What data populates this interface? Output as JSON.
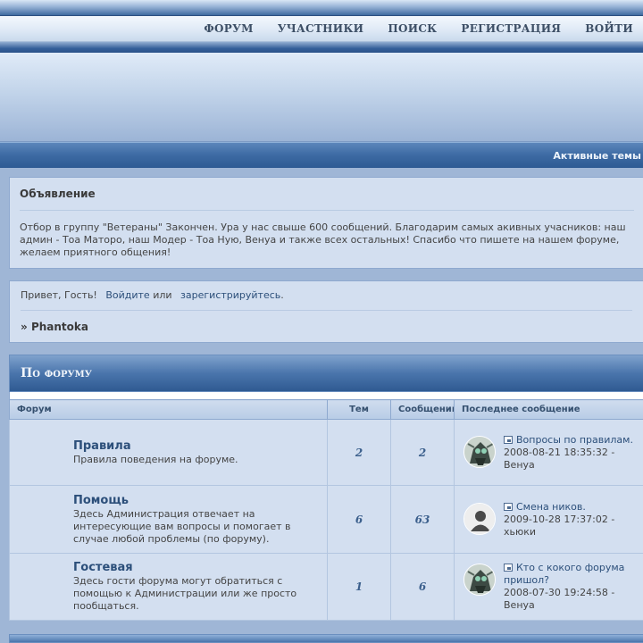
{
  "nav": {
    "items": [
      {
        "label": "ФОРУМ"
      },
      {
        "label": "УЧАСТНИКИ"
      },
      {
        "label": "ПОИСК"
      },
      {
        "label": "РЕГИСТРАЦИЯ"
      },
      {
        "label": "ВОЙТИ"
      }
    ]
  },
  "subbar": {
    "active_topics": "Активные темы"
  },
  "announcement": {
    "title": "Объявление",
    "text": "Отбор в группу \"Ветераны\" Закончен. Ура у нас свыше 600 сообщений. Благодарим самых акивных учасников: наш админ - Тоа Маторо, наш Модер - Тоа Ную, Венуа и также всех остальных! Спасибо что пишете на нашем форуме, желаем приятного общения!"
  },
  "welcome": {
    "greeting": "Привет, Гость!",
    "login": "Войдите",
    "or": "или",
    "register": "зарегистрируйтесь",
    "period": ".",
    "crumb_prefix": "»",
    "crumb": "Phantoka"
  },
  "category": {
    "title": "По форуму",
    "headers": {
      "forum": "Форум",
      "topics": "Тем",
      "posts": "Сообщений",
      "last": "Последнее сообщение"
    },
    "rows": [
      {
        "title": "Правила",
        "desc": "Правила поведения на форуме.",
        "topics": "2",
        "posts": "2",
        "last_topic": "Вопросы по правилам.",
        "last_date": "2008-08-21 18:35:32 -",
        "last_user": "Венуа",
        "avatar": "robot-avatar-icon"
      },
      {
        "title": "Помощь",
        "desc": "Здесь Администрация отвечает на интересующие вам вопросы и помогает в случае любой проблемы (по форуму).",
        "topics": "6",
        "posts": "63",
        "last_topic": "Смена ников.",
        "last_date": "2009-10-28 17:37:02 -",
        "last_user": "хьюки",
        "avatar": "default-user-avatar-icon"
      },
      {
        "title": "Гостевая",
        "desc": "Здесь гости форума могут обратиться с помощью к Администрации или же просто пообщаться.",
        "topics": "1",
        "posts": "6",
        "last_topic": "Кто с кокого форума пришол?",
        "last_date": "2008-07-30 19:24:58 -",
        "last_user": "Венуа",
        "avatar": "robot-avatar-icon"
      }
    ]
  },
  "colors": {
    "page_bg": "#9fb6d6",
    "panel_bg": "#d3dff0",
    "link": "#2c4f7a",
    "header_dark": "#2f5a92"
  }
}
